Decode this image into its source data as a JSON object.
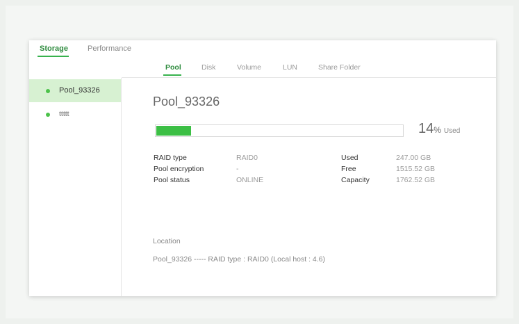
{
  "top_tabs": [
    {
      "label": "Storage",
      "active": true
    },
    {
      "label": "Performance",
      "active": false
    }
  ],
  "sub_tabs": [
    {
      "label": "Pool",
      "active": true
    },
    {
      "label": "Disk",
      "active": false
    },
    {
      "label": "Volume",
      "active": false
    },
    {
      "label": "LUN",
      "active": false
    },
    {
      "label": "Share Folder",
      "active": false
    }
  ],
  "pools": [
    {
      "name": "Pool_93326",
      "active": true
    },
    {
      "name": "ttttt",
      "active": false
    }
  ],
  "detail": {
    "title": "Pool_93326",
    "usage_fraction": 0.14,
    "percent_number": "14",
    "percent_sign": "%",
    "percent_used_label": "Used",
    "info_left": [
      {
        "label": "RAID type",
        "value": "RAID0"
      },
      {
        "label": "Pool encryption",
        "value": "-"
      },
      {
        "label": "Pool status",
        "value": "ONLINE"
      }
    ],
    "info_right": [
      {
        "label": "Used",
        "value": "247.00 GB"
      },
      {
        "label": "Free",
        "value": "1515.52 GB"
      },
      {
        "label": "Capacity",
        "value": "1762.52 GB"
      }
    ],
    "location_title": "Location",
    "location_text": "Pool_93326 ----- RAID type : RAID0 (Local host : 4.6)"
  },
  "colors": {
    "accent": "#37b24d",
    "progress_fill": "#3cbf45",
    "selected_bg": "#d7f1d2"
  }
}
